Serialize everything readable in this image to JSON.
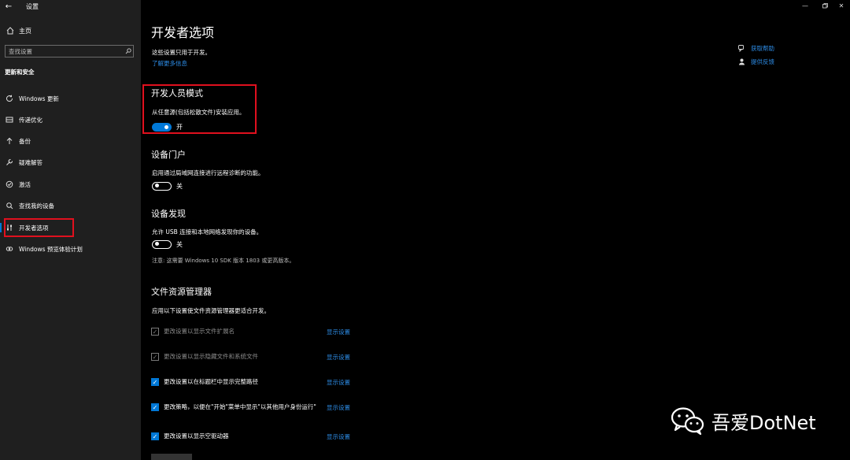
{
  "window": {
    "title": "设置",
    "back_icon": "back-arrow-icon",
    "controls": [
      "minimize-icon",
      "maximize-icon",
      "close-icon"
    ]
  },
  "sidebar": {
    "home_label": "主页",
    "search_placeholder": "查找设置",
    "section_title": "更新和安全",
    "items": [
      {
        "label": "Windows 更新",
        "icon": "refresh-icon"
      },
      {
        "label": "传递优化",
        "icon": "delivery-optimization-icon"
      },
      {
        "label": "备份",
        "icon": "backup-icon"
      },
      {
        "label": "疑难解答",
        "icon": "wrench-icon"
      },
      {
        "label": "激活",
        "icon": "activation-icon"
      },
      {
        "label": "查找我的设备",
        "icon": "find-device-icon"
      },
      {
        "label": "开发者选项",
        "icon": "developer-icon",
        "active": true
      },
      {
        "label": "Windows 预览体验计划",
        "icon": "insider-icon"
      }
    ]
  },
  "main": {
    "title": "开发者选项",
    "intro": "这些设置只用于开发。",
    "learn_more": "了解更多信息",
    "help": [
      {
        "label": "获取帮助",
        "icon": "help-chat-icon"
      },
      {
        "label": "提供反馈",
        "icon": "feedback-icon"
      }
    ],
    "dev_mode": {
      "title": "开发人员模式",
      "desc": "从任意源(包括松散文件)安装应用。",
      "state": "开"
    },
    "device_portal": {
      "title": "设备门户",
      "desc": "启用通过局域网连接进行远程诊断的功能。",
      "state": "关"
    },
    "device_discovery": {
      "title": "设备发现",
      "desc": "允许 USB 连接和本地网络发现你的设备。",
      "state": "关",
      "note": "注意: 这需要 Windows 10 SDK 版本 1803 或更高版本。"
    },
    "file_explorer": {
      "title": "文件资源管理器",
      "desc": "应用以下设置使文件资源管理器更适合开发。",
      "link_label": "显示设置",
      "options": [
        {
          "label": "更改设置以显示文件扩展名",
          "checked": true,
          "enabled": false
        },
        {
          "label": "更改设置以显示隐藏文件和系统文件",
          "checked": true,
          "enabled": false
        },
        {
          "label": "更改设置以在标题栏中显示完整路径",
          "checked": true,
          "enabled": true
        },
        {
          "label": "更改策略，以便在\"开始\"菜单中显示\"以其他用户身份运行\"",
          "checked": true,
          "enabled": true
        },
        {
          "label": "更改设置以显示空驱动器",
          "checked": true,
          "enabled": true
        }
      ]
    }
  },
  "watermark": {
    "text": "吾爱DotNet",
    "icon": "wechat-icon"
  }
}
